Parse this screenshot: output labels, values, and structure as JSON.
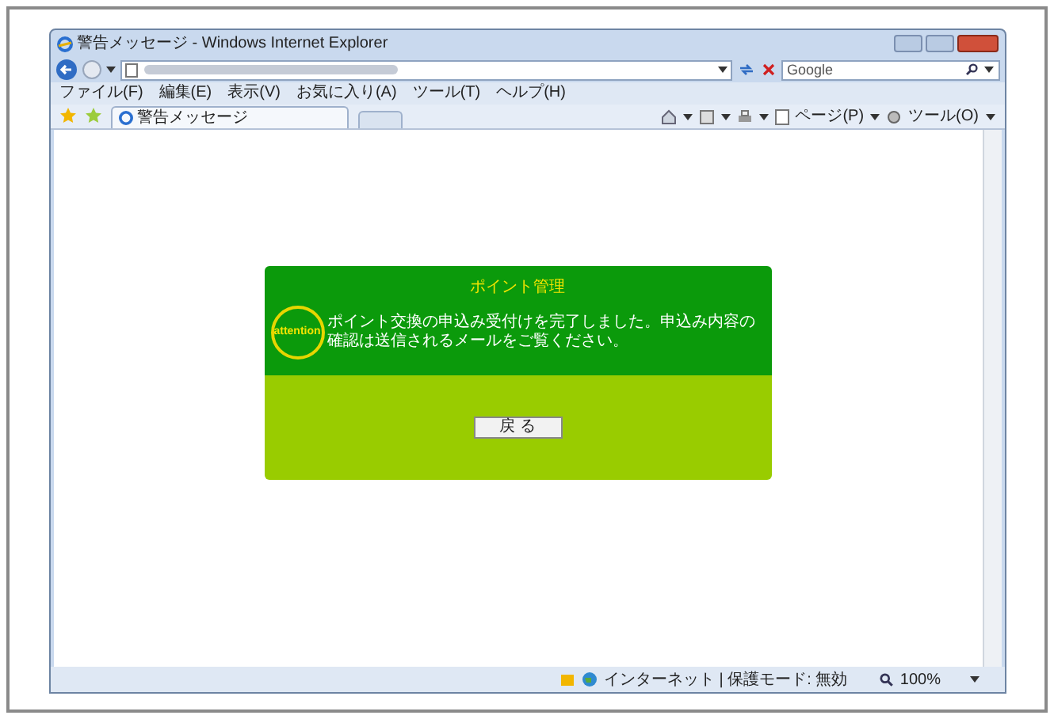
{
  "window": {
    "title": "警告メッセージ - Windows Internet Explorer"
  },
  "search": {
    "placeholder": "Google"
  },
  "menu": [
    "ファイル(F)",
    "編集(E)",
    "表示(V)",
    "お気に入り(A)",
    "ツール(T)",
    "ヘルプ(H)"
  ],
  "tab": {
    "label": "警告メッセージ",
    "selected": true
  },
  "command_bar": [
    "ページ(P)",
    "ツール(O)"
  ],
  "dialog": {
    "title": "ポイント管理",
    "badge": "attention",
    "message": "ポイント交換の申込み受付けを完了しました。申込み内容の確認は送信されるメールをご覧ください。",
    "button": "戻 る"
  },
  "status_bar": {
    "zone": "インターネット | 保護モード: 無効",
    "zoom": "100%"
  }
}
